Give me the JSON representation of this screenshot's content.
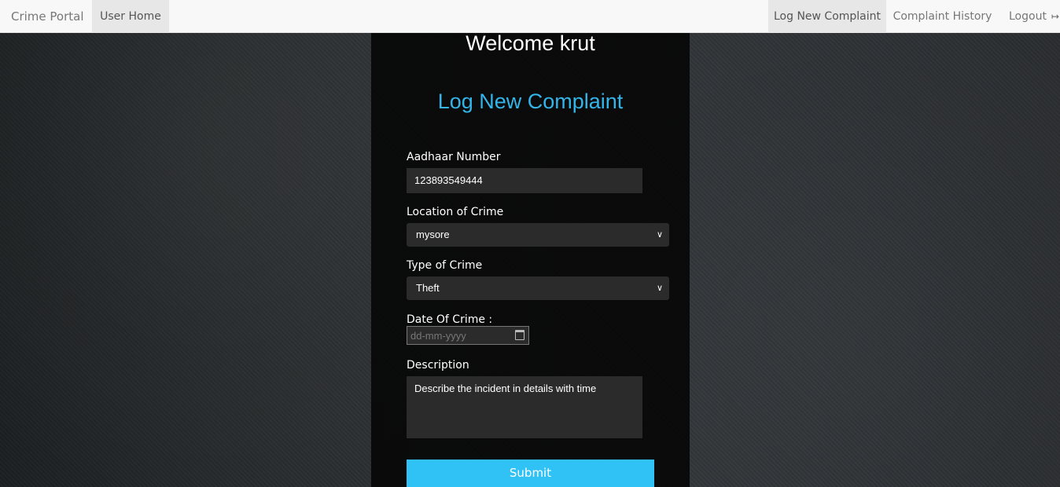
{
  "navbar": {
    "brand": "Crime Portal",
    "user_home": "User Home",
    "log_new_complaint": "Log New Complaint",
    "complaint_history": "Complaint History",
    "logout": "Logout"
  },
  "panel": {
    "welcome": "Welcome krut",
    "title": "Log New Complaint"
  },
  "form": {
    "aadhaar": {
      "label": "Aadhaar Number",
      "value": "123893549444"
    },
    "location": {
      "label": "Location of Crime",
      "selected": "mysore"
    },
    "type": {
      "label": "Type of Crime",
      "selected": "Theft"
    },
    "date": {
      "label": "Date Of Crime :",
      "placeholder": "dd-mm-yyyy"
    },
    "description": {
      "label": "Description",
      "value": "Describe the incident in details with time"
    },
    "submit_label": "Submit"
  },
  "colors": {
    "accent": "#34b5ea",
    "submit": "#30c2f4",
    "panel": "#080808",
    "navbar": "#f8f8f8"
  },
  "icons": {
    "logout": "sign-out-icon",
    "select": "chevron-down-icon",
    "date": "calendar-icon"
  }
}
